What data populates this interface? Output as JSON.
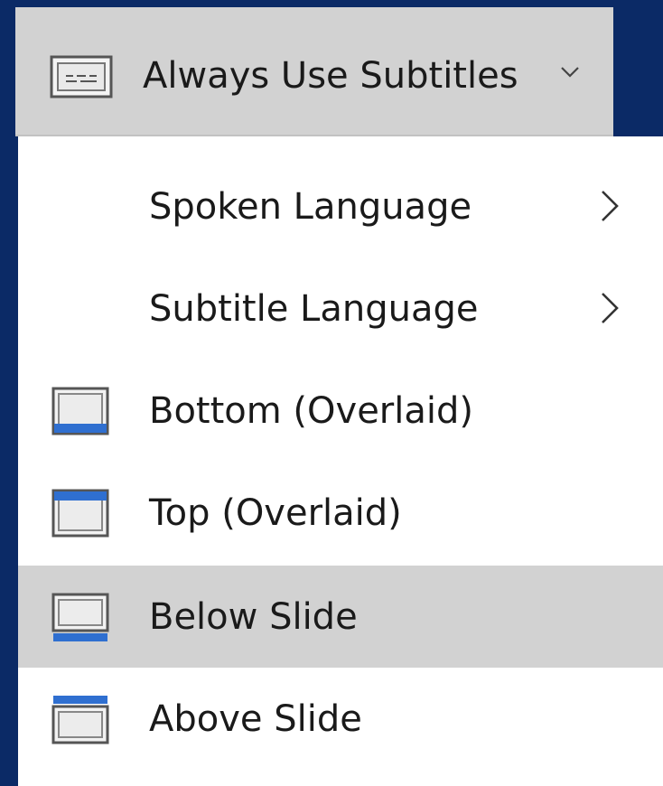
{
  "dropdown": {
    "label": "Always Use Subtitles",
    "icon": "subtitles-icon",
    "chevron": "chevron-down-icon"
  },
  "menu": {
    "items": [
      {
        "label": "Spoken Language",
        "icon": "",
        "has_submenu": true,
        "selected": false
      },
      {
        "label": "Subtitle Language",
        "icon": "",
        "has_submenu": true,
        "selected": false
      },
      {
        "label": "Bottom (Overlaid)",
        "icon": "subtitle-bottom-overlaid-icon",
        "has_submenu": false,
        "selected": false
      },
      {
        "label": "Top (Overlaid)",
        "icon": "subtitle-top-overlaid-icon",
        "has_submenu": false,
        "selected": false
      },
      {
        "label": "Below Slide",
        "icon": "subtitle-below-slide-icon",
        "has_submenu": false,
        "selected": true
      },
      {
        "label": "Above Slide",
        "icon": "subtitle-above-slide-icon",
        "has_submenu": false,
        "selected": false
      }
    ]
  },
  "colors": {
    "background": "#0b2a66",
    "menu_background": "#ffffff",
    "highlight": "#d2d2d2",
    "accent_blue": "#2f6fd0",
    "text": "#1a1a1a"
  }
}
